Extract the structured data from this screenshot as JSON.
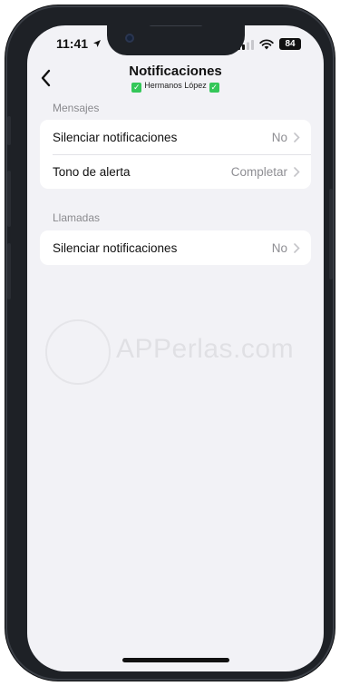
{
  "status_bar": {
    "time": "11:41",
    "battery": "84"
  },
  "nav": {
    "back_icon": "chevron-left-icon",
    "title": "Notificaciones",
    "subtitle": "Hermanos López",
    "subtitle_badge_icon": "check-mark-button-icon"
  },
  "sections": {
    "messages": {
      "header": "Mensajes",
      "rows": [
        {
          "label": "Silenciar notificaciones",
          "value": "No"
        },
        {
          "label": "Tono de alerta",
          "value": "Completar"
        }
      ]
    },
    "calls": {
      "header": "Llamadas",
      "rows": [
        {
          "label": "Silenciar notificaciones",
          "value": "No"
        }
      ]
    }
  },
  "watermark": {
    "text": "APPerlas.com"
  },
  "colors": {
    "background": "#f2f2f6",
    "card": "#ffffff",
    "secondary_text": "#8e8e93",
    "badge_green": "#34c759"
  }
}
